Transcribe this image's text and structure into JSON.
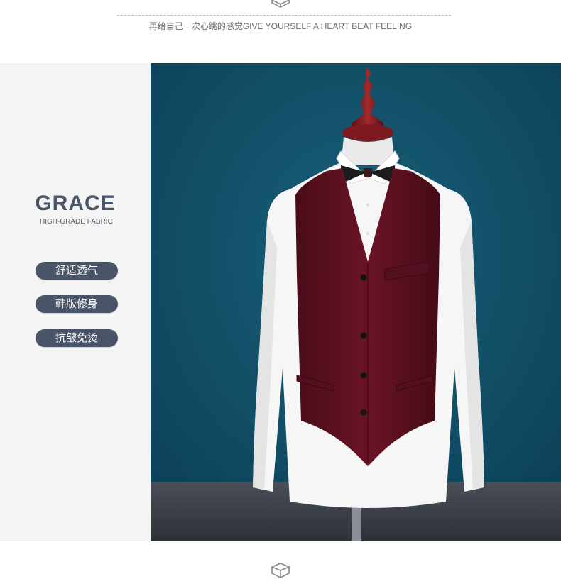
{
  "header": {
    "slogan": "再给自己一次心跳的感觉GIVE YOURSELF A HEART BEAT FEELING",
    "icon": "box-icon"
  },
  "sidebar": {
    "brand": "GRACE",
    "brand_sub": "HIGH-GRADE FABRIC",
    "features": [
      "舒适透气",
      "韩版修身",
      "抗皱免烫"
    ]
  },
  "product_photo": {
    "subject": "mannequin wearing burgundy suit vest over white shirt with bow tie",
    "colors": {
      "backdrop": "#0f4d66",
      "vest": "#5e1020",
      "shirt": "#f7f7f7",
      "floor": "#3a3f47",
      "mannequin_stand": "#8a1d24"
    }
  },
  "footer": {
    "icon": "box-icon"
  },
  "colors": {
    "accent": "#4a5468",
    "panel": "#f4f4f4"
  }
}
